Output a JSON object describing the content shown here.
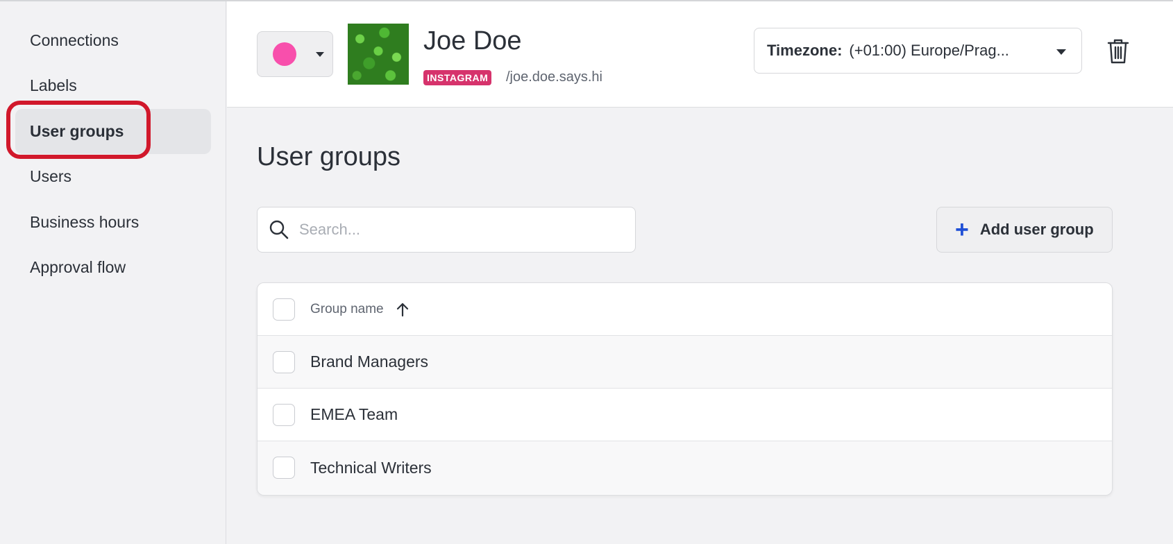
{
  "sidebar": {
    "items": [
      {
        "label": "Connections",
        "active": false
      },
      {
        "label": "Labels",
        "active": false
      },
      {
        "label": "User groups",
        "active": true
      },
      {
        "label": "Users",
        "active": false
      },
      {
        "label": "Business hours",
        "active": false
      },
      {
        "label": "Approval flow",
        "active": false
      }
    ]
  },
  "header": {
    "color_dot": "#f84fac",
    "account_name": "Joe Doe",
    "platform_badge": "INSTAGRAM",
    "handle": "/joe.doe.says.hi",
    "timezone_label": "Timezone:",
    "timezone_value": "(+01:00) Europe/Prag..."
  },
  "main": {
    "title": "User groups",
    "search_placeholder": "Search...",
    "add_button_label": "Add user group",
    "table": {
      "column_header": "Group name",
      "rows": [
        "Brand Managers",
        "EMEA Team",
        "Technical Writers"
      ]
    }
  },
  "colors": {
    "accent_blue": "#1f4fd6",
    "badge_pink": "#d6336c",
    "highlight_red": "#d1182b"
  }
}
